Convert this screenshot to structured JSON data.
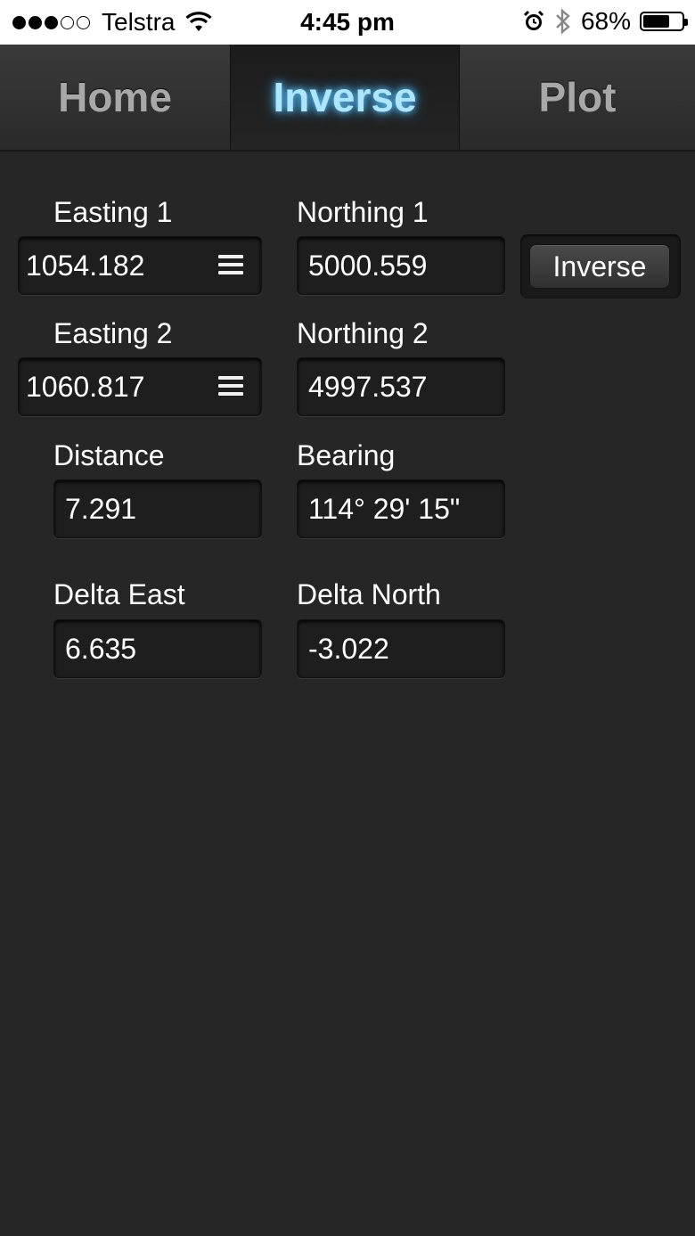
{
  "status_bar": {
    "carrier": "Telstra",
    "time": "4:45 pm",
    "battery": "68%",
    "battery_level": 0.68
  },
  "tabs": [
    {
      "label": "Home",
      "active": false
    },
    {
      "label": "Inverse",
      "active": true
    },
    {
      "label": "Plot",
      "active": false
    }
  ],
  "form": {
    "easting1": {
      "label": "Easting 1",
      "value": "1054.182"
    },
    "northing1": {
      "label": "Northing 1",
      "value": "5000.559"
    },
    "easting2": {
      "label": "Easting 2",
      "value": "1060.817"
    },
    "northing2": {
      "label": "Northing 2",
      "value": "4997.537"
    },
    "distance": {
      "label": "Distance",
      "value": "7.291"
    },
    "bearing": {
      "label": "Bearing",
      "value": "114° 29' 15\""
    },
    "delta_east": {
      "label": "Delta East",
      "value": "6.635"
    },
    "delta_north": {
      "label": "Delta North",
      "value": "-3.022"
    },
    "inverse_button": "Inverse"
  },
  "colors": {
    "background": "#262626",
    "active_tab_glow": "#aee6ff",
    "inactive_tab": "#a8a8a8"
  }
}
